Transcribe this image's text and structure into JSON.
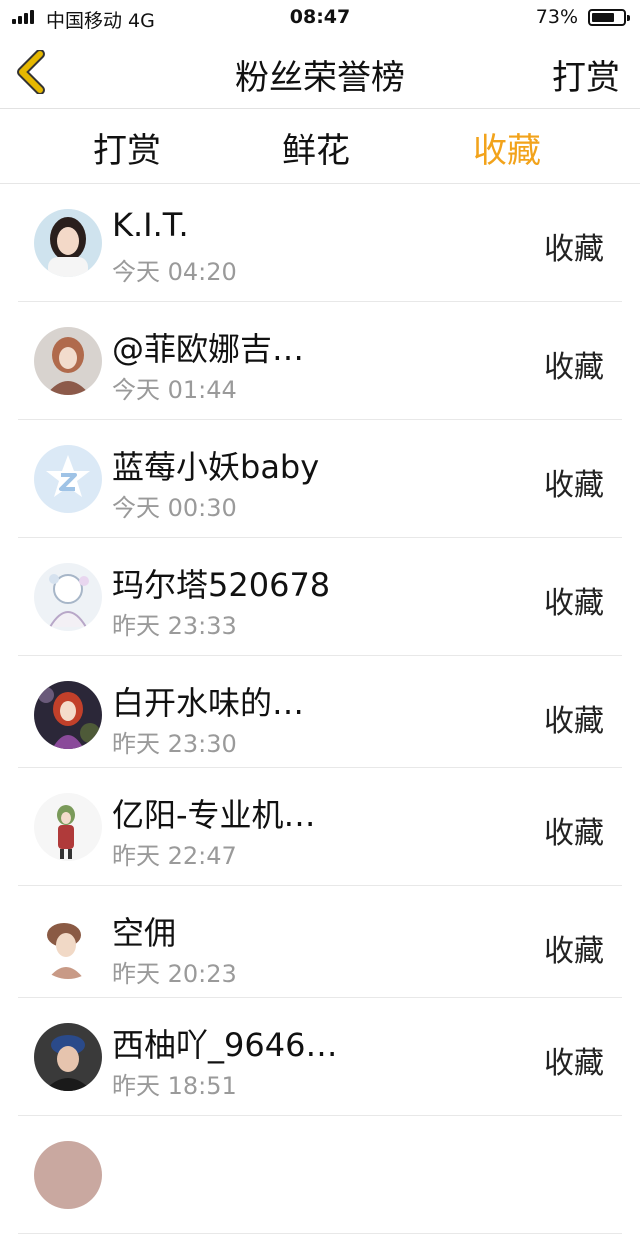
{
  "status_bar": {
    "carrier": "中国移动  4G",
    "time": "08:47",
    "battery_pct": "73%",
    "battery_level": 0.73
  },
  "nav": {
    "title": "粉丝荣誉榜",
    "right_label": "打赏"
  },
  "tabs": [
    {
      "label": "打赏"
    },
    {
      "label": "鲜花"
    },
    {
      "label": "收藏",
      "active": true
    }
  ],
  "colors": {
    "accent": "#f2a31b",
    "back_icon": "#e6b800"
  },
  "list": [
    {
      "name": "K.I.T.",
      "time": "今天 04:20",
      "action": "收藏",
      "avatar": "avatar-girl"
    },
    {
      "name": "@菲欧娜吉…",
      "time": "今天 01:44",
      "action": "收藏",
      "avatar": "avatar-anime"
    },
    {
      "name": "蓝莓小妖baby",
      "time": "今天 00:30",
      "action": "收藏",
      "avatar": "avatar-default"
    },
    {
      "name": "玛尔塔520678",
      "time": "昨天 23:33",
      "action": "收藏",
      "avatar": "avatar-sketch"
    },
    {
      "name": "白开水味的…",
      "time": "昨天 23:30",
      "action": "收藏",
      "avatar": "avatar-anime-dark"
    },
    {
      "name": "亿阳-专业机…",
      "time": "昨天 22:47",
      "action": "收藏",
      "avatar": "avatar-figure"
    },
    {
      "name": "空佣",
      "time": "昨天 20:23",
      "action": "收藏",
      "avatar": "avatar-drawing"
    },
    {
      "name": "西柚吖_9646…",
      "time": "昨天 18:51",
      "action": "收藏",
      "avatar": "avatar-photo"
    }
  ]
}
